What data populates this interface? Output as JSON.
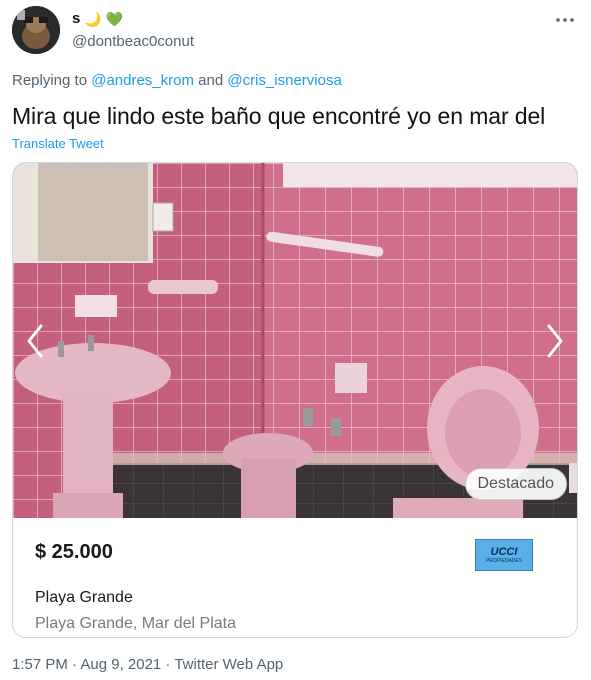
{
  "tweet": {
    "display_name": "s",
    "emojis": [
      "🌙",
      "💚"
    ],
    "handle": "@dontbeac0conut",
    "replying_prefix": "Replying to",
    "reply_user_1": "@andres_krom",
    "reply_and": "and",
    "reply_user_2": "@cris_isnerviosa",
    "text": "Mira que lindo este baño que encontré yo en mar del",
    "translate_label": "Translate Tweet",
    "timestamp": "1:57 PM · Aug 9, 2021 · Twitter Web App"
  },
  "listing": {
    "badge": "Destacado",
    "price": "$ 25.000",
    "location_title": "Playa Grande",
    "location_sub": "Playa Grande, Mar del Plata",
    "logo_text": "UCCI",
    "logo_sub": "PROPIEDADES"
  },
  "icons": {
    "more": "more-horizontal-icon",
    "prev": "chevron-left-icon",
    "next": "chevron-right-icon"
  },
  "colors": {
    "link": "#1d9bf0",
    "secondary_text": "#536471",
    "tile_pink": "#c96a86",
    "logo_blue": "#5ab0e6"
  }
}
